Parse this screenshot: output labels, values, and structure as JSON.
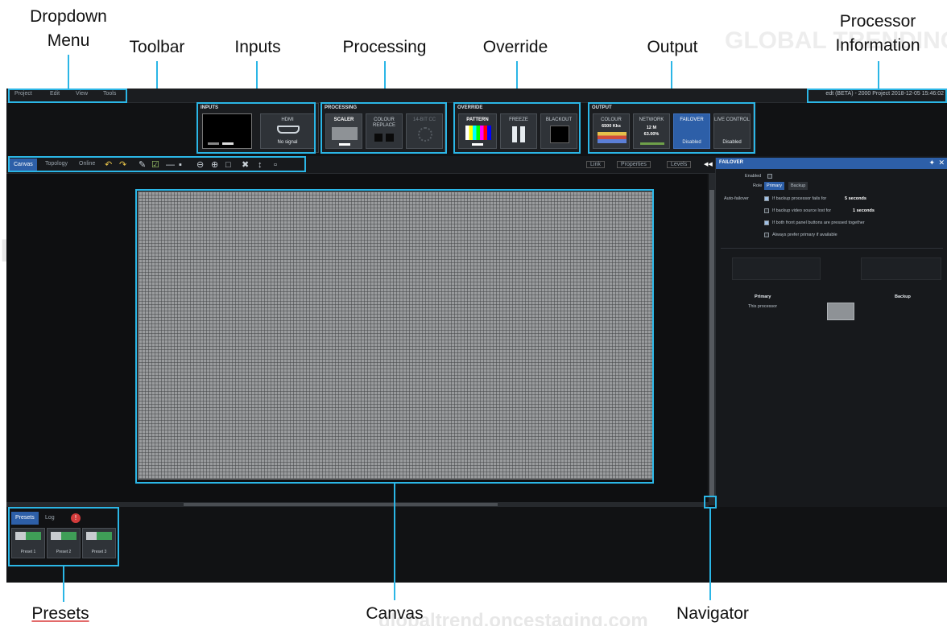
{
  "callouts": {
    "dropdown_menu": [
      "Dropdown",
      "Menu"
    ],
    "toolbar": "Toolbar",
    "inputs": "Inputs",
    "processing": "Processing",
    "override": "Override",
    "output": "Output",
    "processor_information": [
      "Processor",
      "Information"
    ],
    "presets": "Presets",
    "canvas": "Canvas",
    "navigator": "Navigator"
  },
  "watermarks": [
    "GLOBAL TRENDING",
    "globaltrendoncestaging.com",
    "LTREND",
    "globa",
    "GLOBAL TRENI",
    "globaltrend.oncestaging.com"
  ],
  "menu": [
    "Project",
    "Edit",
    "View",
    "Tools"
  ],
  "processor_info": "edt (BETA) - 2000 Project 2018-12-05 15:46:02",
  "inputs": {
    "title": "INPUTS",
    "hdmi_label": "HDMI",
    "hdmi_status": "No signal"
  },
  "processing": {
    "title": "PROCESSING",
    "scaler": "SCALER",
    "colour_replace": "COLOUR REPLACE",
    "third": "14-BIT CC"
  },
  "override": {
    "title": "OVERRIDE",
    "pattern": "PATTERN",
    "freeze": "FREEZE",
    "blackout": "BLACKOUT"
  },
  "output": {
    "title": "OUTPUT",
    "colour": "COLOUR",
    "colour_value": "6500 Kks",
    "network": "NETWORK",
    "network_value": "12 M",
    "network_pct": "63.00%",
    "failover": "FAILOVER",
    "failover_status": "Disabled",
    "live_control": "LIVE CONTROL",
    "live_status": "Disabled"
  },
  "tabs": [
    "Canvas",
    "Topology",
    "Online"
  ],
  "view_toggles": [
    "Link",
    "Properties",
    "Levels",
    "◀◀"
  ],
  "panel": {
    "title": "FAILOVER",
    "enabled": "Enabled",
    "role": "Role",
    "primary_btn": "Primary",
    "backup_btn": "Backup",
    "auto_failover": "Auto-failover",
    "opt1": "If backup processor fails for",
    "opt1_val": "5 seconds",
    "opt2": "If backup video source lost for",
    "opt2_val": "1 seconds",
    "opt3": "If both front panel buttons are pressed together",
    "opt4": "Always prefer primary if available",
    "col_primary": "Primary",
    "col_backup": "Backup",
    "this_processor": "This processor"
  },
  "bottom_tabs": [
    "Presets",
    "Log"
  ],
  "alert_count": "!",
  "presets": [
    "Preset 1",
    "Preset 2",
    "Preset 3"
  ],
  "colors": {
    "accent": "#2bb6e6",
    "tab_active": "#2d5fa8",
    "background": "#111214"
  },
  "icons": [
    "undo-icon",
    "redo-icon",
    "zoom-in-icon",
    "zoom-out-icon",
    "fit-icon",
    "fullscreen-icon"
  ]
}
